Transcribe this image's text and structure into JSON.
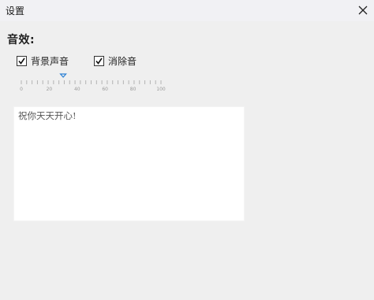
{
  "window": {
    "title": "设置",
    "close_icon": "close-icon"
  },
  "sound": {
    "section_title": "音效:",
    "options": [
      {
        "label": "背景声音",
        "checked": true
      },
      {
        "label": "消除音",
        "checked": true
      }
    ],
    "slider": {
      "tick_labels": [
        "0",
        "20",
        "40",
        "60",
        "80",
        "100"
      ],
      "value": 30,
      "range": [
        0,
        100
      ]
    }
  },
  "editor": {
    "text": "祝你天天开心!"
  },
  "colors": {
    "titlebar": "#f1f1f4",
    "background": "#efefef",
    "slider_thumb": "#2a7fd4",
    "tick": "#b3b3b3"
  }
}
